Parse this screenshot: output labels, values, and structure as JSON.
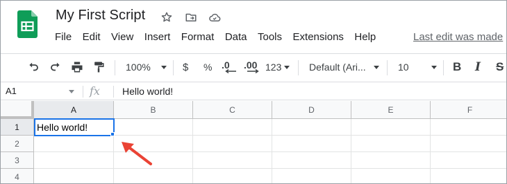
{
  "document": {
    "title": "My First Script",
    "last_edit": "Last edit was made"
  },
  "menu": [
    "File",
    "Edit",
    "View",
    "Insert",
    "Format",
    "Data",
    "Tools",
    "Extensions",
    "Help"
  ],
  "toolbar": {
    "zoom": "100%",
    "currency": "$",
    "percent": "%",
    "decrease_decimal": ".0",
    "increase_decimal": ".00",
    "more_formats": "123",
    "font": "Default (Ari...",
    "font_size": "10",
    "bold": "B",
    "italic": "I",
    "strikethrough": "S"
  },
  "formula_bar": {
    "cell_ref": "A1",
    "fx": "fx",
    "value": "Hello world!"
  },
  "grid": {
    "columns": [
      "A",
      "B",
      "C",
      "D",
      "E",
      "F"
    ],
    "rows": [
      "1",
      "2",
      "3",
      "4"
    ],
    "cells": {
      "A1": "Hello world!"
    },
    "selected_cell": "A1"
  },
  "colors": {
    "accent": "#1a73e8",
    "sheets_green": "#0f9d58",
    "annotation_arrow": "#ea4335"
  }
}
